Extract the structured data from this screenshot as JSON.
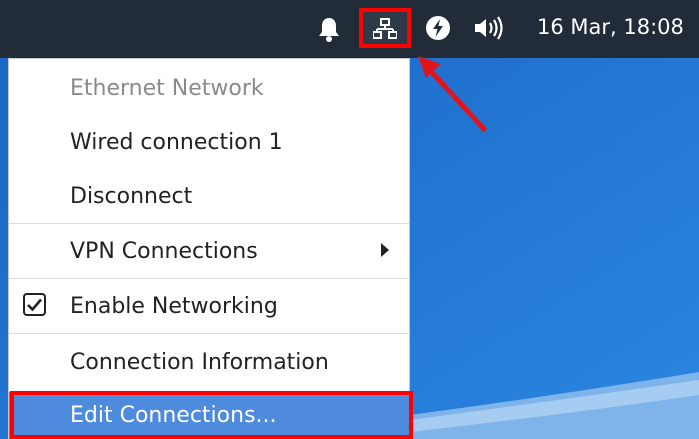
{
  "panel": {
    "clock": "16 Mar, 18:08",
    "icons": [
      "bell-icon",
      "network-icon",
      "power-icon",
      "volume-icon"
    ]
  },
  "menu": {
    "items": [
      {
        "label": "Ethernet Network",
        "type": "header"
      },
      {
        "label": "Wired connection 1",
        "type": "item"
      },
      {
        "label": "Disconnect",
        "type": "item"
      },
      {
        "label": "VPN Connections",
        "type": "submenu"
      },
      {
        "label": "Enable Networking",
        "type": "checkbox",
        "checked": true
      },
      {
        "label": "Connection Information",
        "type": "item"
      },
      {
        "label": "Edit Connections...",
        "type": "item",
        "highlighted": true
      }
    ]
  },
  "colors": {
    "panel_bg": "#222b38",
    "desktop_bg": "#1f6fd0",
    "menu_highlight": "#4e8bdc",
    "annotation": "#ff0000"
  }
}
